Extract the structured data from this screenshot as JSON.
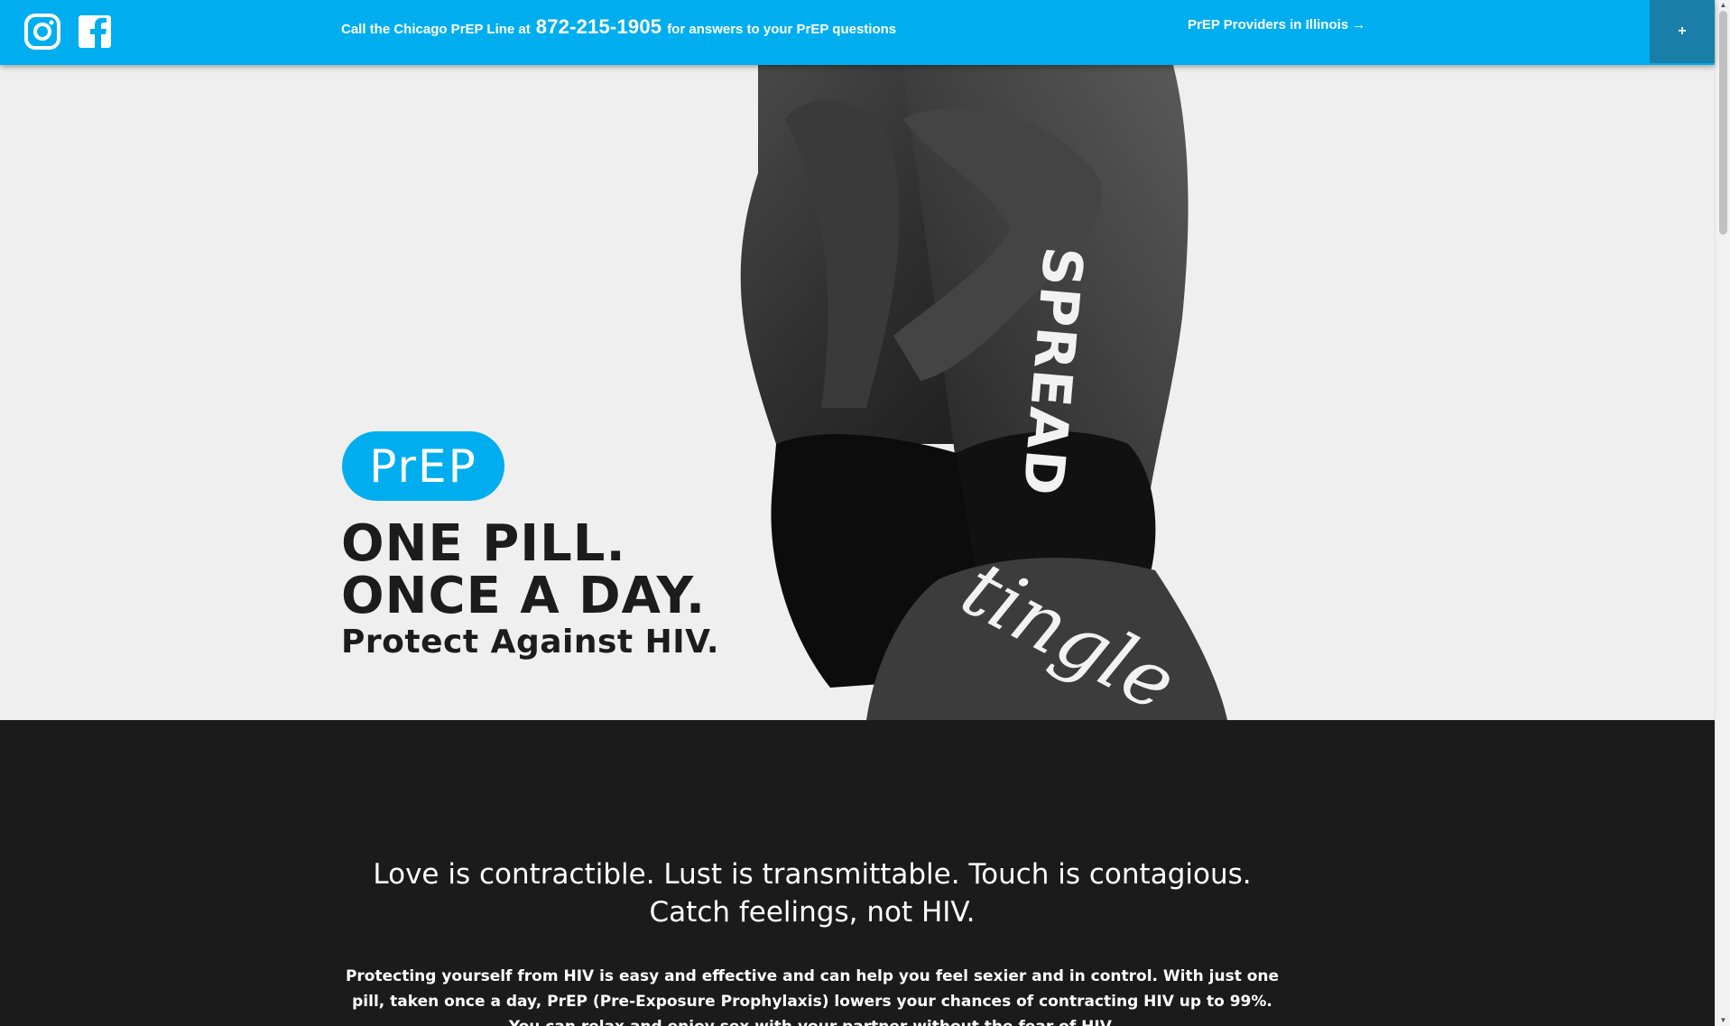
{
  "topbar": {
    "call_prefix": "Call the Chicago PrEP Line at",
    "phone": "872-215-1905",
    "call_suffix": "for answers to your PrEP questions",
    "providers_link": "PrEP Providers in Illinois →",
    "menu_button": "+",
    "social": [
      {
        "icon": "instagram-icon"
      },
      {
        "icon": "facebook-icon"
      }
    ]
  },
  "hero": {
    "logo_text": "PrEP",
    "headline_line1": "ONE PILL.",
    "headline_line2": "ONCE A DAY.",
    "headline_line3": "Protect Against HIV.",
    "photo_words": [
      "SPREAD",
      "tingle"
    ]
  },
  "intro": {
    "tagline_line1": "Love is contractible. Lust is transmittable. Touch is contagious.",
    "tagline_line2": "Catch feelings, not HIV.",
    "body": "Protecting yourself from HIV is easy and effective and can help you feel sexier and in control. With just one pill, taken once a day, PrEP (Pre-Exposure Prophylaxis) lowers your chances of contracting HIV up to 99%. You can relax and enjoy sex with your partner without the fear of HIV."
  },
  "colors": {
    "brand_blue": "#00aeef",
    "dark_bg": "#1b1b1c",
    "hero_bg": "#efefef"
  }
}
